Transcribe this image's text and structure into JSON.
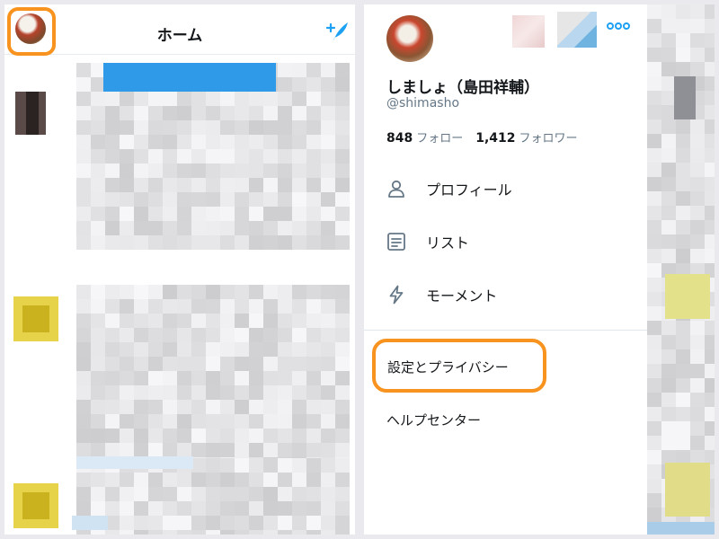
{
  "left_screen": {
    "header": {
      "title": "ホーム",
      "avatar_icon": "profile-avatar",
      "compose_icon": "compose-tweet-icon",
      "highlight_color": "#f7931e",
      "accent_color": "#1da1f2"
    }
  },
  "right_screen": {
    "profile": {
      "name": "しましょ（島田祥輔）",
      "handle": "@shimasho",
      "following_count": "848",
      "following_label": "フォロー",
      "followers_count": "1,412",
      "followers_label": "フォロワー"
    },
    "more_icon": "more-horizontal-icon",
    "menu": [
      {
        "label": "プロフィール",
        "icon": "person-icon"
      },
      {
        "label": "リスト",
        "icon": "list-icon"
      },
      {
        "label": "モーメント",
        "icon": "lightning-icon"
      }
    ],
    "settings_label": "設定とプライバシー",
    "help_label": "ヘルプセンター",
    "highlight_color": "#f7931e"
  }
}
